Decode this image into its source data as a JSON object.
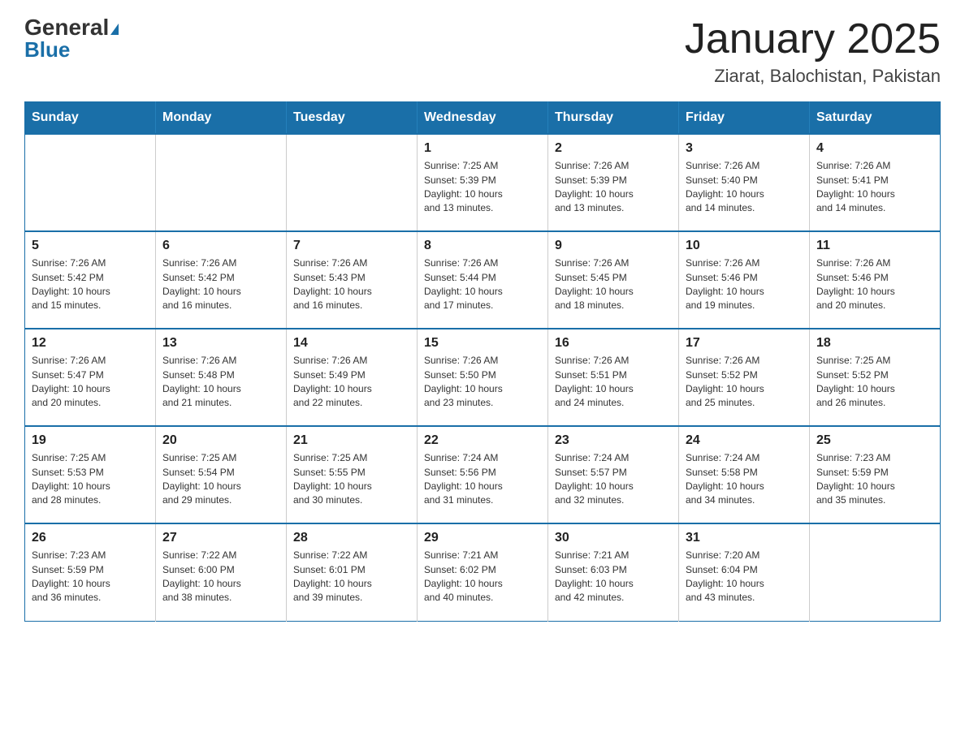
{
  "logo": {
    "general": "General",
    "blue": "Blue"
  },
  "title": "January 2025",
  "subtitle": "Ziarat, Balochistan, Pakistan",
  "days_header": [
    "Sunday",
    "Monday",
    "Tuesday",
    "Wednesday",
    "Thursday",
    "Friday",
    "Saturday"
  ],
  "weeks": [
    [
      {
        "day": "",
        "info": ""
      },
      {
        "day": "",
        "info": ""
      },
      {
        "day": "",
        "info": ""
      },
      {
        "day": "1",
        "info": "Sunrise: 7:25 AM\nSunset: 5:39 PM\nDaylight: 10 hours\nand 13 minutes."
      },
      {
        "day": "2",
        "info": "Sunrise: 7:26 AM\nSunset: 5:39 PM\nDaylight: 10 hours\nand 13 minutes."
      },
      {
        "day": "3",
        "info": "Sunrise: 7:26 AM\nSunset: 5:40 PM\nDaylight: 10 hours\nand 14 minutes."
      },
      {
        "day": "4",
        "info": "Sunrise: 7:26 AM\nSunset: 5:41 PM\nDaylight: 10 hours\nand 14 minutes."
      }
    ],
    [
      {
        "day": "5",
        "info": "Sunrise: 7:26 AM\nSunset: 5:42 PM\nDaylight: 10 hours\nand 15 minutes."
      },
      {
        "day": "6",
        "info": "Sunrise: 7:26 AM\nSunset: 5:42 PM\nDaylight: 10 hours\nand 16 minutes."
      },
      {
        "day": "7",
        "info": "Sunrise: 7:26 AM\nSunset: 5:43 PM\nDaylight: 10 hours\nand 16 minutes."
      },
      {
        "day": "8",
        "info": "Sunrise: 7:26 AM\nSunset: 5:44 PM\nDaylight: 10 hours\nand 17 minutes."
      },
      {
        "day": "9",
        "info": "Sunrise: 7:26 AM\nSunset: 5:45 PM\nDaylight: 10 hours\nand 18 minutes."
      },
      {
        "day": "10",
        "info": "Sunrise: 7:26 AM\nSunset: 5:46 PM\nDaylight: 10 hours\nand 19 minutes."
      },
      {
        "day": "11",
        "info": "Sunrise: 7:26 AM\nSunset: 5:46 PM\nDaylight: 10 hours\nand 20 minutes."
      }
    ],
    [
      {
        "day": "12",
        "info": "Sunrise: 7:26 AM\nSunset: 5:47 PM\nDaylight: 10 hours\nand 20 minutes."
      },
      {
        "day": "13",
        "info": "Sunrise: 7:26 AM\nSunset: 5:48 PM\nDaylight: 10 hours\nand 21 minutes."
      },
      {
        "day": "14",
        "info": "Sunrise: 7:26 AM\nSunset: 5:49 PM\nDaylight: 10 hours\nand 22 minutes."
      },
      {
        "day": "15",
        "info": "Sunrise: 7:26 AM\nSunset: 5:50 PM\nDaylight: 10 hours\nand 23 minutes."
      },
      {
        "day": "16",
        "info": "Sunrise: 7:26 AM\nSunset: 5:51 PM\nDaylight: 10 hours\nand 24 minutes."
      },
      {
        "day": "17",
        "info": "Sunrise: 7:26 AM\nSunset: 5:52 PM\nDaylight: 10 hours\nand 25 minutes."
      },
      {
        "day": "18",
        "info": "Sunrise: 7:25 AM\nSunset: 5:52 PM\nDaylight: 10 hours\nand 26 minutes."
      }
    ],
    [
      {
        "day": "19",
        "info": "Sunrise: 7:25 AM\nSunset: 5:53 PM\nDaylight: 10 hours\nand 28 minutes."
      },
      {
        "day": "20",
        "info": "Sunrise: 7:25 AM\nSunset: 5:54 PM\nDaylight: 10 hours\nand 29 minutes."
      },
      {
        "day": "21",
        "info": "Sunrise: 7:25 AM\nSunset: 5:55 PM\nDaylight: 10 hours\nand 30 minutes."
      },
      {
        "day": "22",
        "info": "Sunrise: 7:24 AM\nSunset: 5:56 PM\nDaylight: 10 hours\nand 31 minutes."
      },
      {
        "day": "23",
        "info": "Sunrise: 7:24 AM\nSunset: 5:57 PM\nDaylight: 10 hours\nand 32 minutes."
      },
      {
        "day": "24",
        "info": "Sunrise: 7:24 AM\nSunset: 5:58 PM\nDaylight: 10 hours\nand 34 minutes."
      },
      {
        "day": "25",
        "info": "Sunrise: 7:23 AM\nSunset: 5:59 PM\nDaylight: 10 hours\nand 35 minutes."
      }
    ],
    [
      {
        "day": "26",
        "info": "Sunrise: 7:23 AM\nSunset: 5:59 PM\nDaylight: 10 hours\nand 36 minutes."
      },
      {
        "day": "27",
        "info": "Sunrise: 7:22 AM\nSunset: 6:00 PM\nDaylight: 10 hours\nand 38 minutes."
      },
      {
        "day": "28",
        "info": "Sunrise: 7:22 AM\nSunset: 6:01 PM\nDaylight: 10 hours\nand 39 minutes."
      },
      {
        "day": "29",
        "info": "Sunrise: 7:21 AM\nSunset: 6:02 PM\nDaylight: 10 hours\nand 40 minutes."
      },
      {
        "day": "30",
        "info": "Sunrise: 7:21 AM\nSunset: 6:03 PM\nDaylight: 10 hours\nand 42 minutes."
      },
      {
        "day": "31",
        "info": "Sunrise: 7:20 AM\nSunset: 6:04 PM\nDaylight: 10 hours\nand 43 minutes."
      },
      {
        "day": "",
        "info": ""
      }
    ]
  ]
}
